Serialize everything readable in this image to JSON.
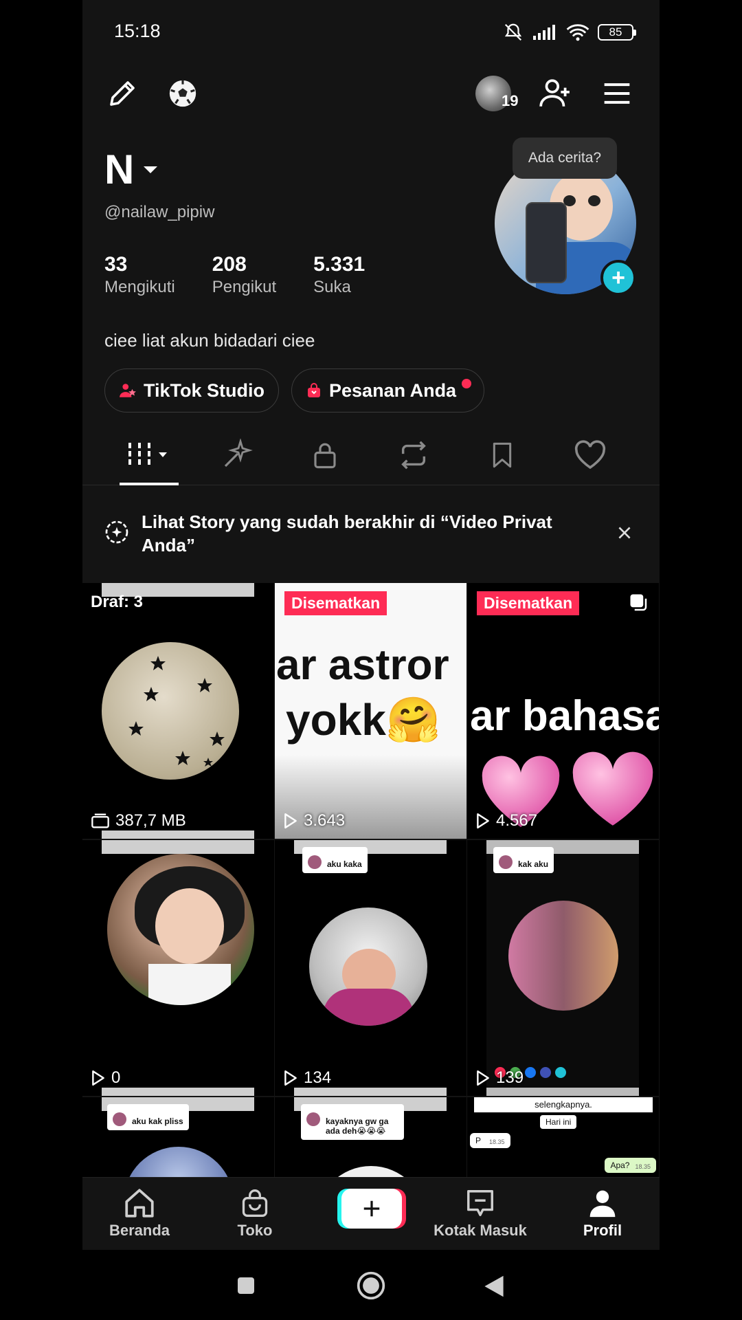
{
  "status": {
    "time": "15:18",
    "battery": "85"
  },
  "topbar": {
    "notif_count": "19"
  },
  "profile": {
    "name": "N",
    "handle": "@nailaw_pipiw",
    "story_tip": "Ada cerita?",
    "bio": "ciee liat akun bidadari ciee",
    "stats": [
      {
        "value": "33",
        "label": "Mengikuti"
      },
      {
        "value": "208",
        "label": "Pengikut"
      },
      {
        "value": "5.331",
        "label": "Suka"
      }
    ]
  },
  "chips": {
    "studio": "TikTok Studio",
    "orders": "Pesanan Anda"
  },
  "banner": {
    "text": "Lihat Story yang sudah berakhir di “Video Privat Anda”"
  },
  "grid": {
    "draft_label": "Draf: 3",
    "draft_size": "387,7 MB",
    "pinned_label": "Disematkan",
    "cell2_text_a": "ar astror",
    "cell2_text_b": "yokk🤗",
    "cell3_text": "ar bahasa",
    "views": [
      "3.643",
      "4.567",
      "0",
      "134",
      "139"
    ],
    "bubbles": [
      "aku kaka",
      "kak aku",
      "aku kak pliss",
      "kayaknya gw ga ada deh😭😭😭"
    ],
    "chat": {
      "header": "selengkapnya.",
      "msg1": "Hari ini",
      "msg2": "P",
      "msg2_time": "18.35",
      "msg3": "Apa?",
      "msg3_time": "18.35"
    }
  },
  "nav": {
    "home": "Beranda",
    "shop": "Toko",
    "inbox": "Kotak Masuk",
    "profile": "Profil"
  },
  "colors": {
    "accent_red": "#fe2c55",
    "accent_cyan": "#25f4ee",
    "story_plus": "#20c2d7",
    "bg": "#141414"
  }
}
